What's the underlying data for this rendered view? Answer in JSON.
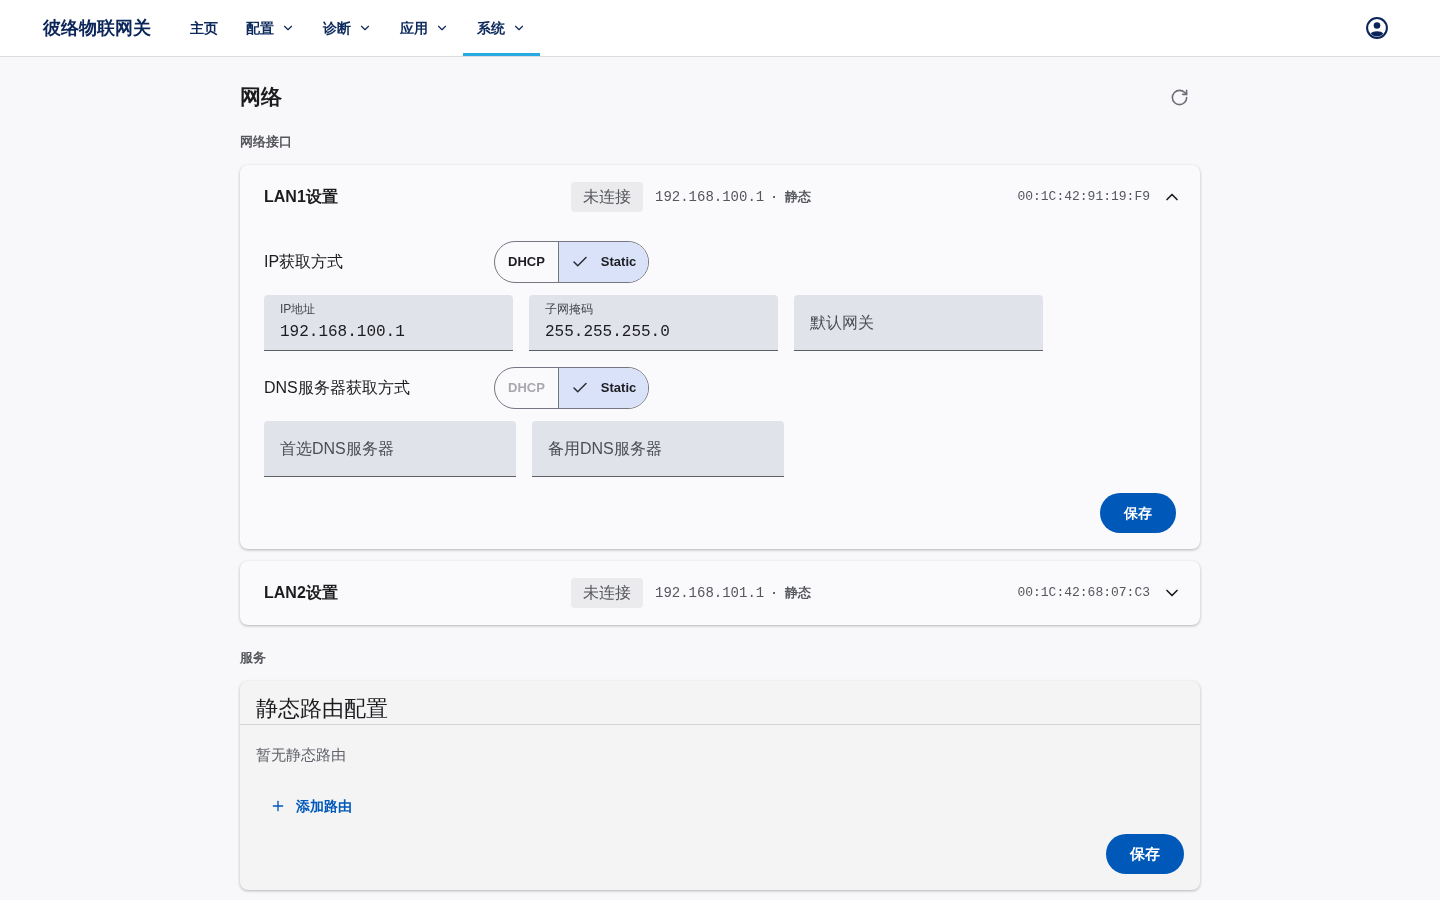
{
  "header": {
    "brand": "彼络物联网关",
    "nav": [
      {
        "label": "主页",
        "selected": false,
        "has_menu": false
      },
      {
        "label": "配置",
        "selected": false,
        "has_menu": true
      },
      {
        "label": "诊断",
        "selected": false,
        "has_menu": true
      },
      {
        "label": "应用",
        "selected": false,
        "has_menu": true
      },
      {
        "label": "系统",
        "selected": true,
        "has_menu": true
      }
    ]
  },
  "page": {
    "title": "网络"
  },
  "interfaces_section": {
    "label": "网络接口",
    "interfaces": [
      {
        "name": "LAN1设置",
        "status": "未连接",
        "ip": "192.168.100.1",
        "separator": "·",
        "mode": "静态",
        "mac": "00:1C:42:91:19:F9",
        "expanded": true,
        "ip_method": {
          "label": "IP获取方式",
          "options": [
            {
              "label": "DHCP",
              "selected": false,
              "disabled": false
            },
            {
              "label": "Static",
              "selected": true,
              "disabled": false
            }
          ]
        },
        "ip_fields": [
          {
            "label": "IP地址",
            "value": "192.168.100.1"
          },
          {
            "label": "子网掩码",
            "value": "255.255.255.0"
          },
          {
            "placeholder": "默认网关"
          }
        ],
        "dns_method": {
          "label": "DNS服务器获取方式",
          "options": [
            {
              "label": "DHCP",
              "selected": false,
              "disabled": true
            },
            {
              "label": "Static",
              "selected": true,
              "disabled": false
            }
          ]
        },
        "dns_fields": [
          {
            "placeholder": "首选DNS服务器"
          },
          {
            "placeholder": "备用DNS服务器"
          }
        ],
        "save_button": "保存"
      },
      {
        "name": "LAN2设置",
        "status": "未连接",
        "ip": "192.168.101.1",
        "separator": "·",
        "mode": "静态",
        "mac": "00:1C:42:68:07:C3",
        "expanded": false
      }
    ]
  },
  "services_section": {
    "label": "服务",
    "static_routes": {
      "title": "静态路由配置",
      "empty_text": "暂无静态路由",
      "add_button": "添加路由",
      "save_button": "保存"
    }
  }
}
